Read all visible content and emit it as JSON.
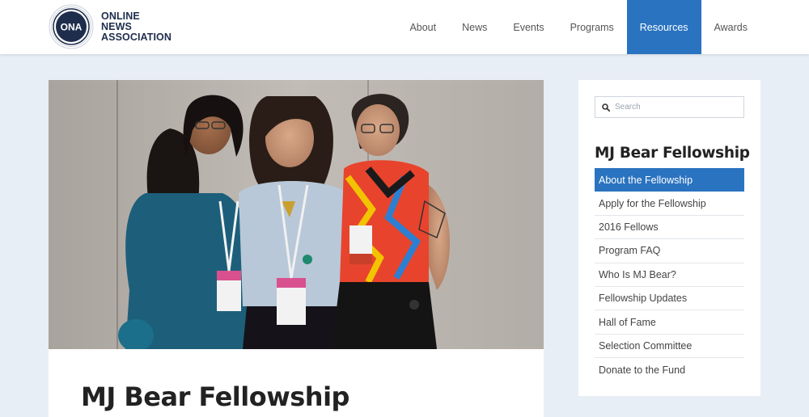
{
  "header": {
    "logo": {
      "badge_text": "ONA",
      "line1": "ONLINE NEWS",
      "line2": "ASSOCIATION"
    },
    "nav": [
      {
        "label": "About",
        "name": "nav-about",
        "active": false
      },
      {
        "label": "News",
        "name": "nav-news",
        "active": false
      },
      {
        "label": "Events",
        "name": "nav-events",
        "active": false
      },
      {
        "label": "Programs",
        "name": "nav-programs",
        "active": false
      },
      {
        "label": "Resources",
        "name": "nav-resources",
        "active": true
      },
      {
        "label": "Awards",
        "name": "nav-awards",
        "active": false
      }
    ]
  },
  "main": {
    "hero_image": "photo-three-women-with-conference-badges",
    "title": "MJ Bear Fellowship"
  },
  "sidebar": {
    "search_placeholder": "Search",
    "title": "MJ Bear Fellowship",
    "items": [
      {
        "label": "About the Fellowship",
        "active": true
      },
      {
        "label": "Apply for the Fellowship",
        "active": false
      },
      {
        "label": "2016 Fellows",
        "active": false
      },
      {
        "label": "Program FAQ",
        "active": false
      },
      {
        "label": "Who Is MJ Bear?",
        "active": false
      },
      {
        "label": "Fellowship Updates",
        "active": false
      },
      {
        "label": "Hall of Fame",
        "active": false
      },
      {
        "label": "Selection Committee",
        "active": false
      },
      {
        "label": "Donate to the Fund",
        "active": false
      }
    ]
  },
  "colors": {
    "accent": "#2a73c0",
    "background": "#e8eef5",
    "logo_navy": "#1f2d4d"
  }
}
